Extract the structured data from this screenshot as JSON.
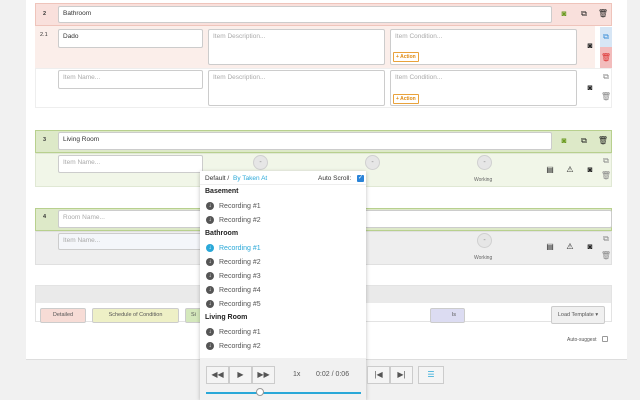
{
  "rooms": [
    {
      "number": "2",
      "name": "Bathroom",
      "items": [
        {
          "number": "2.1",
          "name": "Dado",
          "description_placeholder": "Item Description...",
          "condition_placeholder": "Item Condition...",
          "action": "Action"
        },
        {
          "name_placeholder": "Item Name...",
          "description_placeholder": "Item Description...",
          "condition_placeholder": "Item Condition...",
          "action": "Action"
        }
      ]
    },
    {
      "number": "3",
      "name": "Living Room",
      "item_name_placeholder": "Item Name...",
      "status": "Working",
      "circle": "-"
    },
    {
      "number": "4",
      "name_placeholder": "Room Name...",
      "item_name_placeholder": "Item Name...",
      "status": "Working",
      "circle": "-"
    }
  ],
  "templates": {
    "detailed": "Detailed",
    "schedule": "Schedule of Condition",
    "s": "Si",
    "ls": "ls",
    "load": "Load Template ▾"
  },
  "auto_suggest": "Auto-suggest",
  "popup": {
    "sort_default": "Default /",
    "sort_taken": "By Taken At",
    "auto_scroll": "Auto Scroll:",
    "groups": [
      {
        "name": "Basement",
        "recordings": [
          "Recording #1",
          "Recording #2"
        ]
      },
      {
        "name": "Bathroom",
        "recordings": [
          "Recording #1",
          "Recording #2",
          "Recording #3",
          "Recording #4",
          "Recording #5"
        ]
      },
      {
        "name": "Living Room",
        "recordings": [
          "Recording #1",
          "Recording #2"
        ]
      }
    ],
    "active": "Bathroom / Recording #1",
    "speed": "1x",
    "time": "0:02 / 0:06",
    "progress_percent": 35
  },
  "colors": {
    "accent": "#2aa8d8",
    "bathroom": "#f9e0dc",
    "living": "#dde9c8"
  }
}
